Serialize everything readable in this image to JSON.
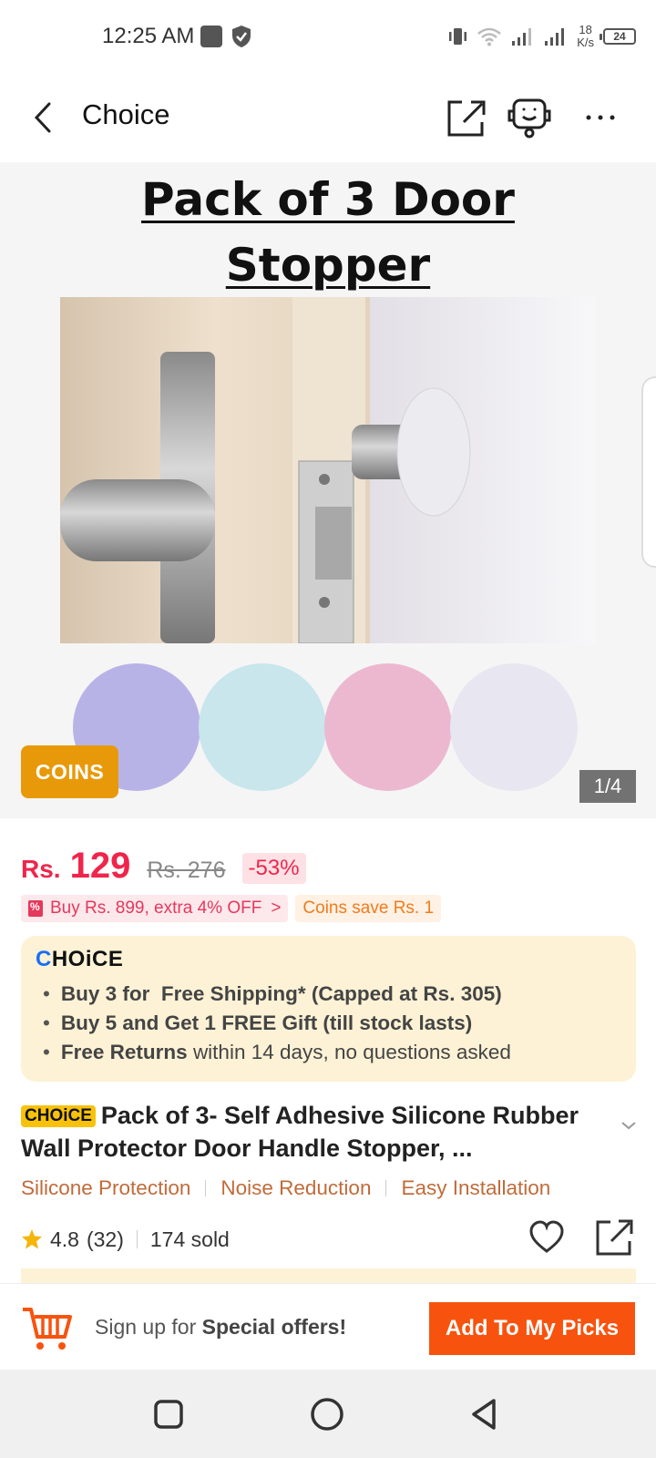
{
  "status_bar": {
    "time": "12:25 AM",
    "net_speed_value": "18",
    "net_speed_unit": "K/s",
    "battery": "24"
  },
  "header": {
    "title": "Choice"
  },
  "hero": {
    "title_line1": "Pack of 3 Door",
    "title_line2": "Stopper",
    "coins_badge": "COINS",
    "image_counter": "1/4",
    "stopper_colors": [
      "#b8b3e6",
      "#c8e6ec",
      "#ecb8d0",
      "#e8e6f0"
    ]
  },
  "price": {
    "currency": "Rs.",
    "value": "129",
    "original": "Rs. 276",
    "discount": "-53%"
  },
  "promos": {
    "extra_off": "Buy Rs. 899, extra 4% OFF",
    "chevron": ">",
    "coins_save": "Coins save Rs. 1"
  },
  "choice_box": {
    "logo_c": "C",
    "logo_rest": "HOiCE",
    "items": [
      {
        "bold": "Buy 3 for  Free Shipping* (Capped at Rs. 305)",
        "rest": ""
      },
      {
        "bold": "Buy 5 and Get 1 FREE Gift (till stock lasts)",
        "rest": ""
      },
      {
        "bold": "Free Returns ",
        "rest": "within 14 days, no questions asked"
      }
    ]
  },
  "product": {
    "choice_pill": "CHOiCE",
    "title": "Pack of 3- Self Adhesive Silicone Rubber Wall Protector Door Handle Stopper, ...",
    "features": [
      "Silicone Protection",
      "Noise Reduction",
      "Easy Installation"
    ],
    "rating": "4.8",
    "reviews": "(32)",
    "sold": "174 sold"
  },
  "bottom_bar": {
    "signup_prefix": "Sign up for ",
    "signup_bold": "Special offers!",
    "cta": "Add To My Picks"
  },
  "colors": {
    "accent_red": "#f0254c",
    "cta_orange": "#f7530f",
    "coins_orange": "#e8990a",
    "choice_yellow": "#f8c20c",
    "feature_brown": "#c06b3a"
  }
}
